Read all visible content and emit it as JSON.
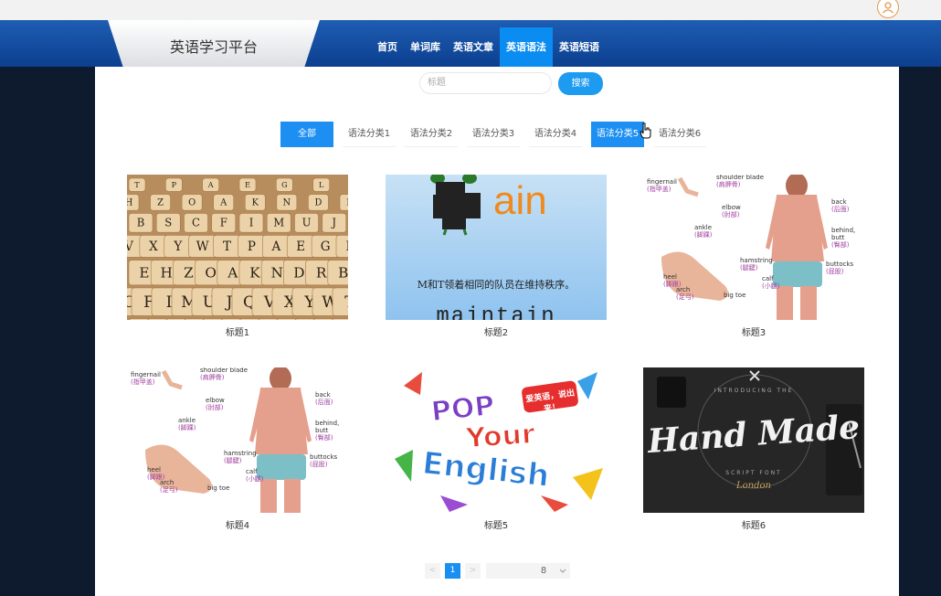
{
  "header": {
    "brand": "英语学习平台"
  },
  "nav": {
    "items": [
      {
        "label": "首页"
      },
      {
        "label": "单词库"
      },
      {
        "label": "英语文章"
      },
      {
        "label": "英语语法",
        "active": true
      },
      {
        "label": "英语短语"
      }
    ]
  },
  "search": {
    "placeholder": "标题",
    "button": "搜索"
  },
  "categories": [
    "全部",
    "语法分类1",
    "语法分类2",
    "语法分类3",
    "语法分类4",
    "语法分类5",
    "语法分类6"
  ],
  "cards": [
    {
      "title": "标题1",
      "image": "letter-blocks"
    },
    {
      "title": "标题2",
      "image": "word-card",
      "word_part": "ain",
      "sentence": "M和T领着相同的队员在维持秩序。",
      "word": "maintain"
    },
    {
      "title": "标题3",
      "image": "body-parts-chart",
      "labels": [
        "fingernail",
        "(指甲盖)",
        "shoulder blade",
        "(肩胛骨)",
        "elbow",
        "(肘部)",
        "back",
        "(后面)",
        "behind,",
        "butt",
        "(臀部)",
        "ankle",
        "(脚踝)",
        "hamstring",
        "(腿腱)",
        "buttocks",
        "(屁股)",
        "calf",
        "(小腿)",
        "heel",
        "(脚跟)",
        "arch",
        "(足弓)",
        "big toe"
      ]
    },
    {
      "title": "标题4",
      "image": "body-parts-chart",
      "labels": [
        "fingernail",
        "(指甲盖)",
        "shoulder blade",
        "(肩胛骨)",
        "elbow",
        "(肘部)",
        "back",
        "(后面)",
        "behind,",
        "butt",
        "(臀部)",
        "ankle",
        "(脚踝)",
        "hamstring",
        "(腿腱)",
        "buttocks",
        "(屁股)",
        "calf",
        "(小腿)",
        "heel",
        "(脚跟)",
        "arch",
        "(足弓)",
        "big toe"
      ]
    },
    {
      "title": "标题5",
      "image": "pop-your-english",
      "banner": "爱英语，说出来！",
      "line1": "POP",
      "line2": "Your",
      "line3": "English"
    },
    {
      "title": "标题6",
      "image": "hand-made-font",
      "script": "Hand Made",
      "signature": "London",
      "ring": "INTRODUCING THE",
      "subline": "SCRIPT FONT"
    }
  ],
  "pagination": {
    "prev": "<",
    "current": "1",
    "next": ">",
    "page_size": "8"
  },
  "colors": {
    "nav": "#1559b0",
    "accent": "#1d8ff2"
  }
}
